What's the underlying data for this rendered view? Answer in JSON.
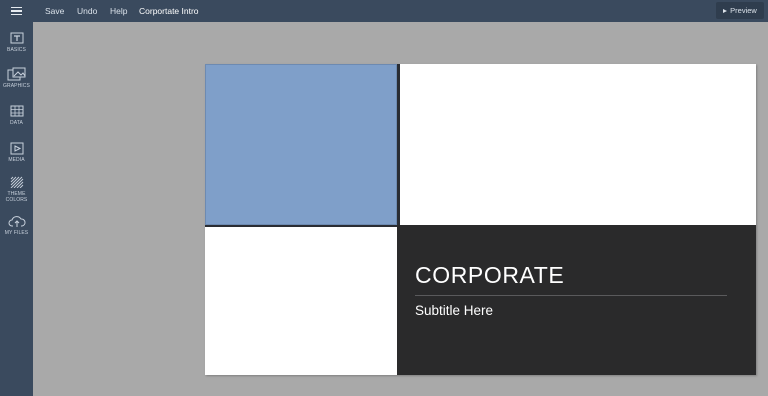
{
  "topbar": {
    "menu_icon": "hamburger-menu-icon",
    "save_label": "Save",
    "undo_label": "Undo",
    "help_label": "Help",
    "document_title": "Corportate Intro",
    "preview_label": "Preview",
    "preview_icon": "play-icon"
  },
  "sidebar": {
    "items": [
      {
        "label": "BASICS",
        "icon": "text-icon"
      },
      {
        "label": "GRAPHICS",
        "icon": "images-icon"
      },
      {
        "label": "DATA",
        "icon": "table-icon"
      },
      {
        "label": "MEDIA",
        "icon": "video-icon"
      },
      {
        "label": "THEME COLORS",
        "icon": "pattern-icon"
      },
      {
        "label": "MY FILES",
        "icon": "cloud-upload-icon"
      }
    ]
  },
  "slide": {
    "title": "CORPORATE",
    "subtitle": "Subtitle Here",
    "colors": {
      "blue_block": "#7f9fc9",
      "dark_block": "#2a2a2b",
      "background": "#ffffff"
    }
  },
  "colors": {
    "chrome": "#3a4a5e",
    "canvas": "#a9a9a9"
  }
}
